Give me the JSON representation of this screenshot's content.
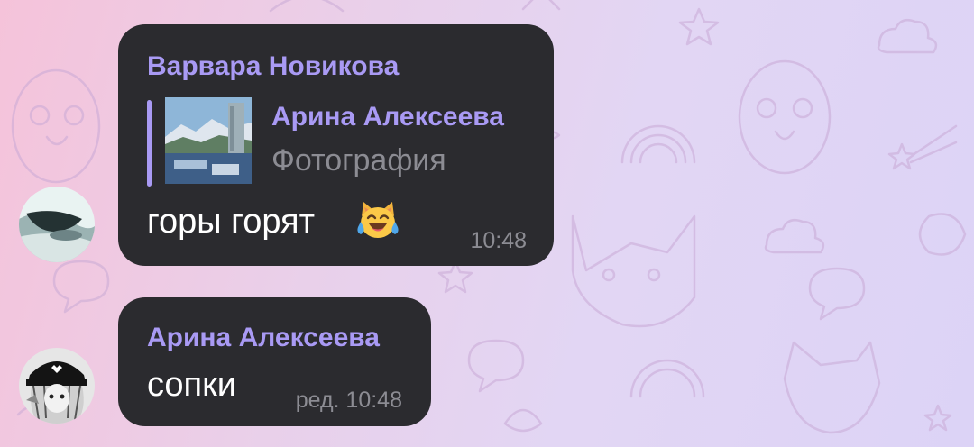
{
  "messages": [
    {
      "sender": "Варвара Новикова",
      "reply": {
        "author": "Арина Алексеева",
        "type": "Фотография",
        "thumbnail": "mountain-photo"
      },
      "text": "горы горят",
      "emoji": "face-with-tears-of-joy-cat",
      "time": "10:48",
      "avatar": "user-avatar-varvara"
    },
    {
      "sender": "Арина Алексеева",
      "text": "сопки",
      "time": "ред. 10:48",
      "avatar": "user-avatar-arina"
    }
  ],
  "colors": {
    "bubble": "#2b2b2f",
    "sender_accent": "#a99af4",
    "message_text": "#ffffff",
    "meta_text": "#8c8c93"
  }
}
